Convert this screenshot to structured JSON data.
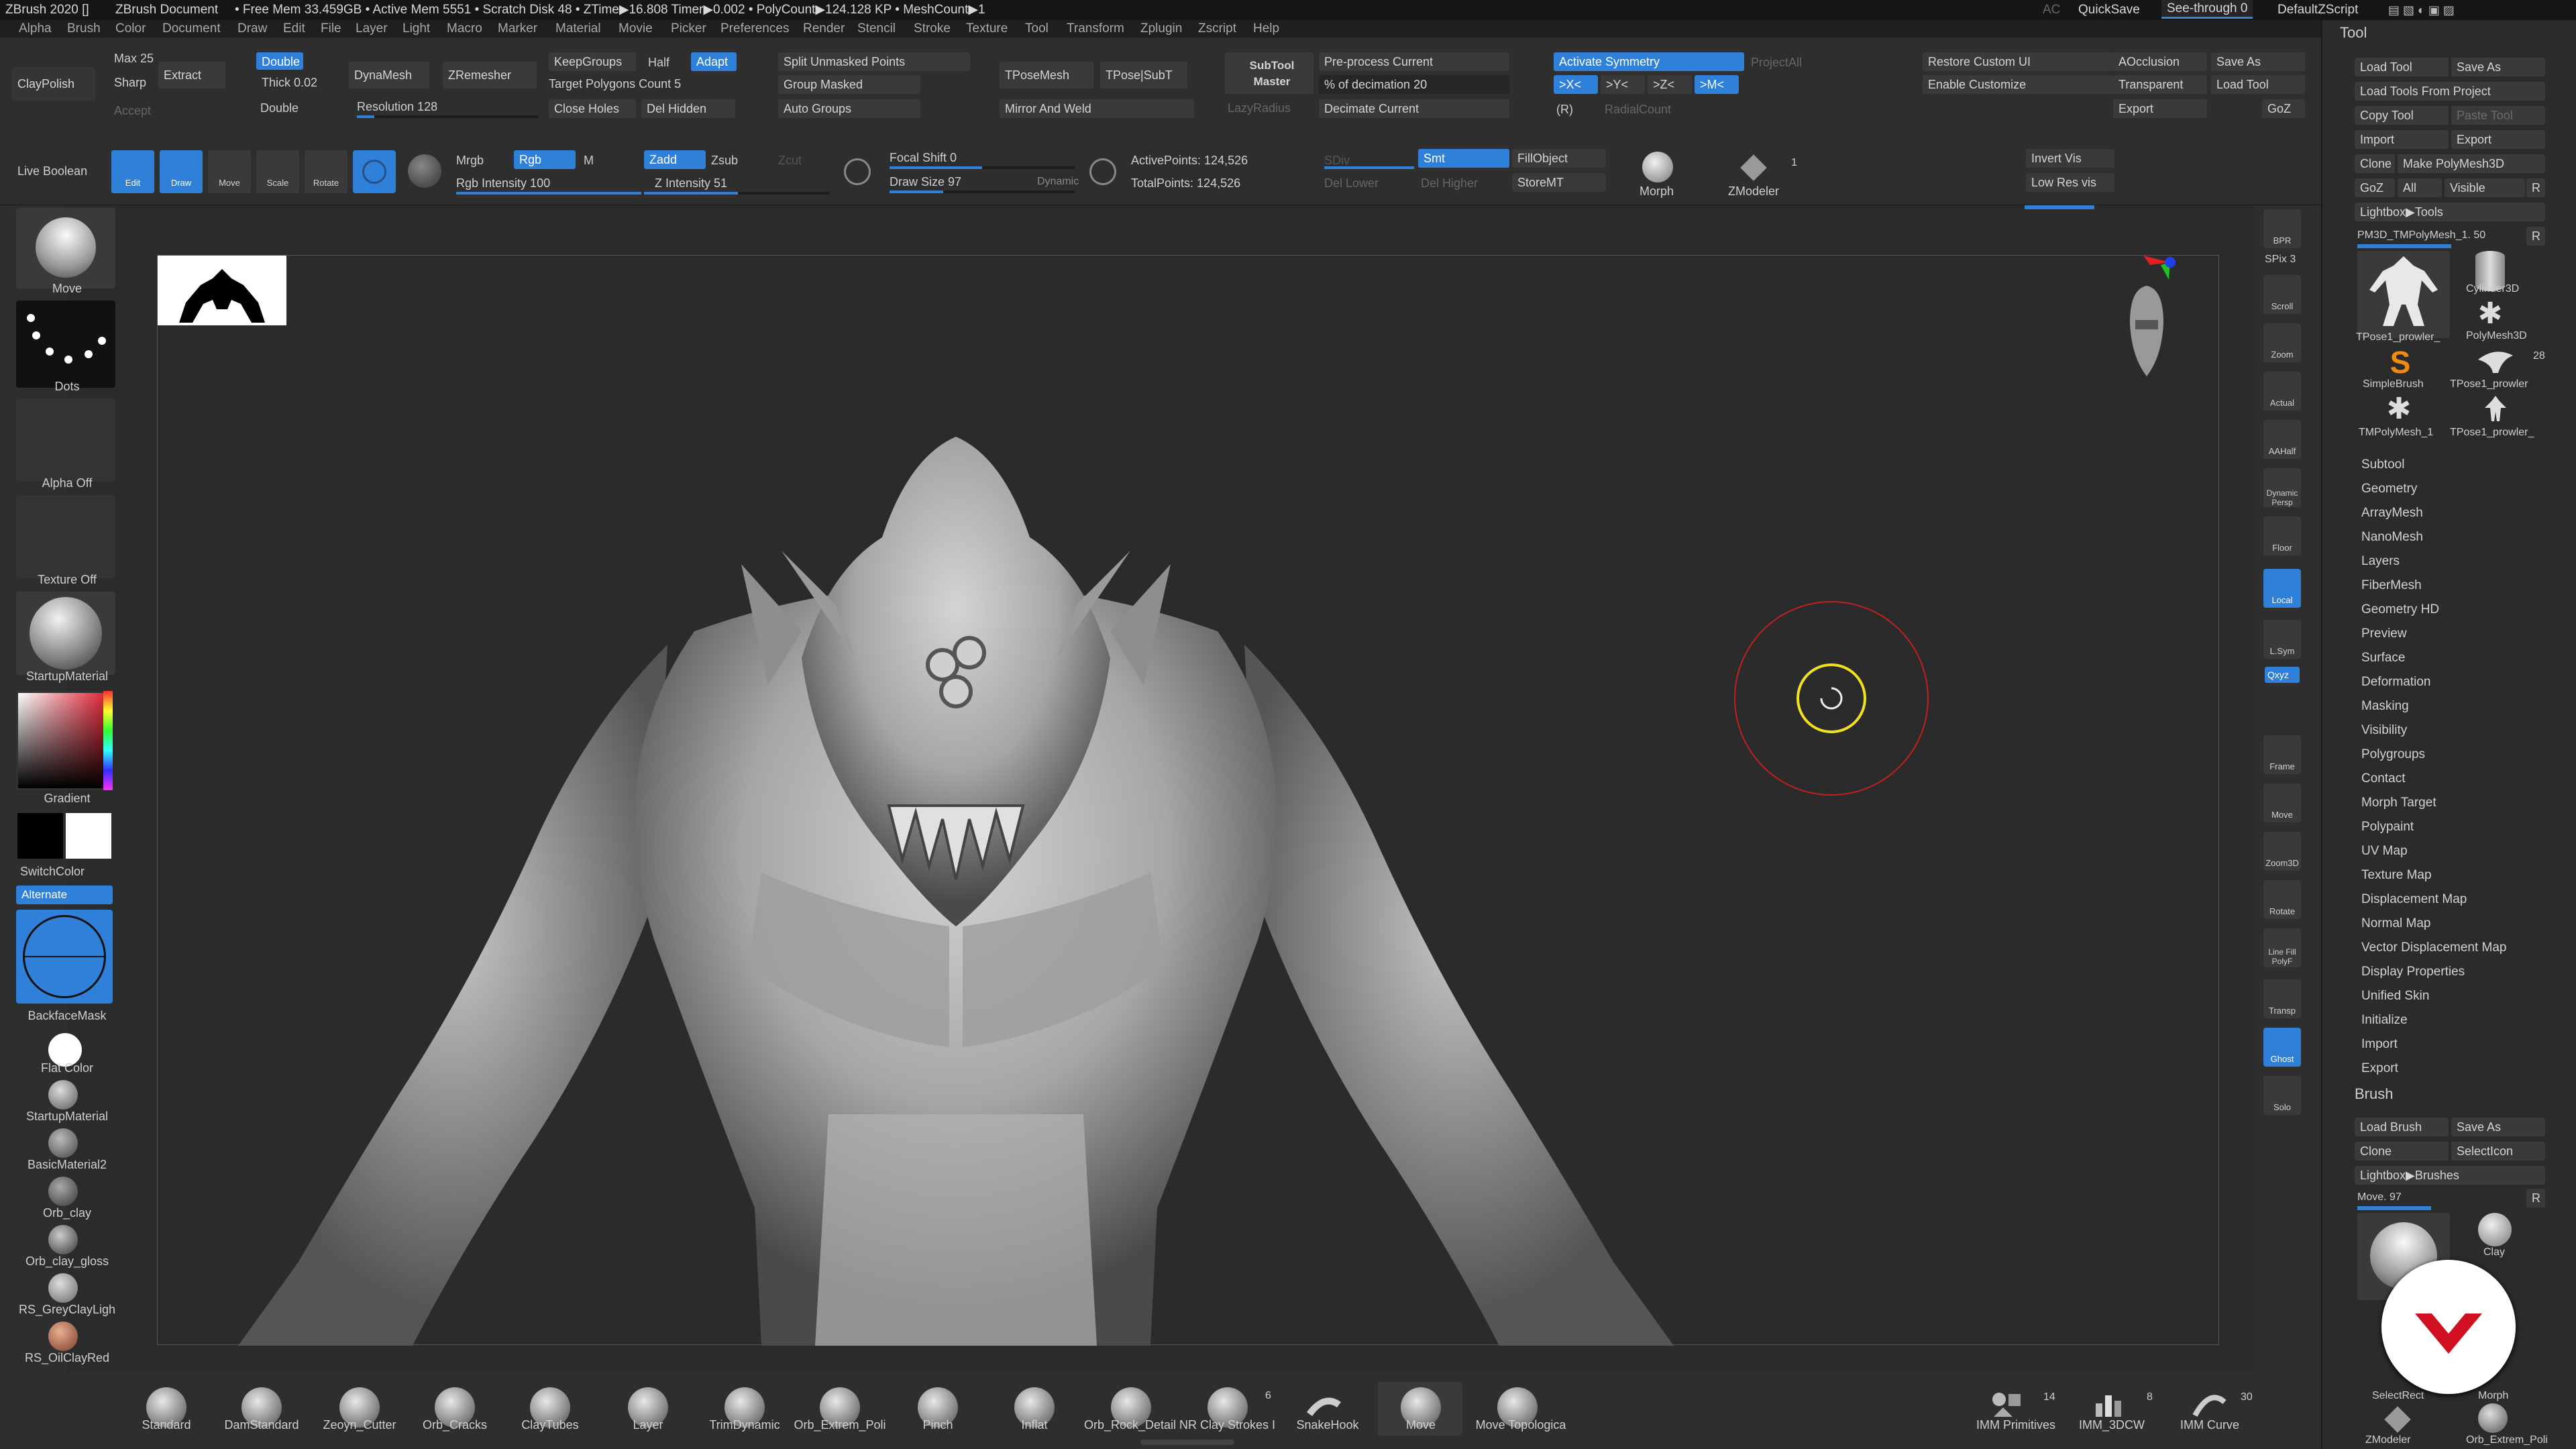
{
  "title_bar": {
    "app": "ZBrush 2020 []",
    "doc": "ZBrush Document",
    "free_mem": "• Free Mem 33.459GB • Active Mem 5551 • Scratch Disk 48 • ZTime▶16.808 Timer▶0.002 • PolyCount▶124.128 KP • MeshCount▶1",
    "ac": "AC",
    "quicksave": "QuickSave",
    "see_through": "See-through  0",
    "script": "DefaultZScript"
  },
  "menu": [
    "Alpha",
    "Brush",
    "Color",
    "Document",
    "Draw",
    "Edit",
    "File",
    "Layer",
    "Light",
    "Macro",
    "Marker",
    "Material",
    "Movie",
    "Picker",
    "Preferences",
    "Render",
    "Stencil",
    "Stroke",
    "Texture",
    "Tool",
    "Transform",
    "Zplugin",
    "Zscript",
    "Help"
  ],
  "top": {
    "claypolish": "ClayPolish",
    "max": "Max 25",
    "sharp": "Sharp",
    "accept": "Accept",
    "extract": "Extract",
    "double1": "Double",
    "thick": "Thick 0.02",
    "double2": "Double",
    "dynamesh": "DynaMesh",
    "zremesher": "ZRemesher",
    "resolution": "Resolution 128",
    "keepgroups": "KeepGroups",
    "half": "Half",
    "adapt": "Adapt",
    "target_poly": "Target Polygons Count 5",
    "close_holes": "Close Holes",
    "del_hidden": "Del Hidden",
    "split_unmasked": "Split Unmasked Points",
    "group_masked": "Group Masked",
    "auto_groups": "Auto Groups",
    "tposemesh": "TPoseMesh",
    "tpose_subt": "TPose|SubT",
    "mirror_weld": "Mirror And Weld",
    "subtool_master": "SubTool Master",
    "lazyradius": "LazyRadius",
    "preprocess": "Pre-process Current",
    "decimation": "% of decimation 20",
    "decimate": "Decimate Current",
    "activate_sym": "Activate Symmetry",
    "projectall": "ProjectAll",
    "x": ">X<",
    "y": ">Y<",
    "z": ">Z<",
    "m": ">M<",
    "r": "(R)",
    "radialcount": "RadialCount",
    "restore_ui": "Restore Custom UI",
    "enable_customize": "Enable Customize",
    "aocclusion": "AOcclusion",
    "transparent": "Transparent",
    "export": "Export",
    "save_as": "Save As",
    "load_tool": "Load Tool",
    "goz": "GoZ"
  },
  "row2": {
    "live_boolean": "Live Boolean",
    "edit": "Edit",
    "draw": "Draw",
    "move": "Move",
    "scale": "Scale",
    "rotate": "Rotate",
    "mrgb": "Mrgb",
    "rgb": "Rgb",
    "m": "M",
    "rgb_intensity": "Rgb Intensity 100",
    "zadd": "Zadd",
    "zsub": "Zsub",
    "zcut": "Zcut",
    "z_intensity": "Z Intensity 51",
    "focal_shift": "Focal Shift 0",
    "draw_size": "Draw Size 97",
    "dynamic": "Dynamic",
    "active_points": "ActivePoints: 124,526",
    "total_points": "TotalPoints: 124,526",
    "sdiv": "SDiv",
    "smt": "Smt",
    "del_lower": "Del Lower",
    "del_higher": "Del Higher",
    "fillobject": "FillObject",
    "storemt": "StoreMT",
    "morph": "Morph",
    "zmodeler": "ZModeler",
    "zmodeler_count": "1",
    "invert_vis": "Invert Vis",
    "low_res_vis": "Low Res vis"
  },
  "left": {
    "move": "Move",
    "dots": "Dots",
    "alpha_off": "Alpha Off",
    "texture_off": "Texture Off",
    "startup_mat": "StartupMaterial",
    "gradient": "Gradient",
    "switchcolor": "SwitchColor",
    "alternate": "Alternate",
    "backfacemask": "BackfaceMask",
    "flat_color": "Flat Color",
    "mats": [
      "StartupMaterial",
      "BasicMaterial2",
      "Orb_clay",
      "Orb_clay_gloss",
      "RS_GreyClayLigh",
      "RS_OilClayRed"
    ]
  },
  "bottom_brushes": [
    "Standard",
    "DamStandard",
    "Zeoyn_Cutter",
    "Orb_Cracks",
    "ClayTubes",
    "Layer",
    "TrimDynamic",
    "Orb_Extrem_Poli",
    "Pinch",
    "Inflat",
    "Orb_Rock_Detail NR",
    "Clay Strokes I",
    "SnakeHook",
    "Move",
    "Move Topologica"
  ],
  "bottom_right": [
    {
      "label": "IMM Primitives",
      "count": "14"
    },
    {
      "label": "IMM_3DCW",
      "count": "8"
    },
    {
      "label": "IMM Curve",
      "count": "30"
    }
  ],
  "clay_strokes_count": "6",
  "right_icons": [
    "BPR",
    "SPix 3",
    "Scroll",
    "Zoom",
    "Actual",
    "AAHalf",
    "Dynamic Persp",
    "Floor",
    "Local",
    "L.Sym",
    "Qxyz",
    "Frame",
    "Move",
    "Zoom3D",
    "Rotate",
    "Line Fill PolyF",
    "Transp",
    "Ghost",
    "Solo"
  ],
  "tool": {
    "title": "Tool",
    "load_tool": "Load Tool",
    "save_as": "Save As",
    "load_from_project": "Load Tools From Project",
    "copy_tool": "Copy Tool",
    "paste_tool": "Paste Tool",
    "import": "Import",
    "export": "Export",
    "clone": "Clone",
    "make_polymesh": "Make PolyMesh3D",
    "goz": "GoZ",
    "all": "All",
    "visible": "Visible",
    "r": "R",
    "lightbox_tools": "Lightbox▶Tools",
    "current_tool": "PM3D_TMPolyMesh_1. 50",
    "thumbs": [
      "TPose1_prowler_",
      "Cylinder3D",
      "SimpleBrush",
      "PolyMesh3D",
      "TMPolyMesh_1",
      "TPose1_prowler"
    ],
    "count": "28",
    "subpalettes": [
      "Subtool",
      "Geometry",
      "ArrayMesh",
      "NanoMesh",
      "Layers",
      "FiberMesh",
      "Geometry HD",
      "Preview",
      "Surface",
      "Deformation",
      "Masking",
      "Visibility",
      "Polygroups",
      "Contact",
      "Morph Target",
      "Polypaint",
      "UV Map",
      "Texture Map",
      "Displacement Map",
      "Normal Map",
      "Vector Displacement Map",
      "Display Properties",
      "Unified Skin",
      "Initialize",
      "Import",
      "Export"
    ]
  },
  "brush": {
    "title": "Brush",
    "load_brush": "Load Brush",
    "save_as": "Save As",
    "clone": "Clone",
    "selecticon": "SelectIcon",
    "lightbox_brushes": "Lightbox▶Brushes",
    "move_value": "Move. 97",
    "r": "R",
    "clay": "Clay",
    "morph": "Morph",
    "selectrect": "SelectRect",
    "orb_extrem": "Orb_Extrem_Poli",
    "zmodeler": "ZModeler"
  },
  "colors": {
    "accent": "#2f80d8",
    "bg": "#2b2b2b",
    "panel": "#2e2e2e"
  }
}
